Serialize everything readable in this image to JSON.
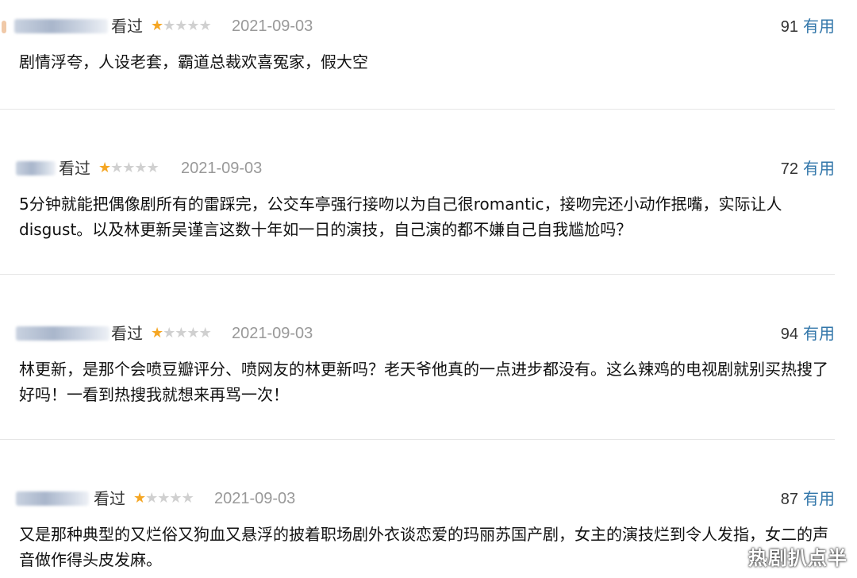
{
  "reviews": [
    {
      "watched": "看过",
      "rating": 1,
      "date": "2021-09-03",
      "useful_count": "91",
      "useful_label": "有用",
      "content": "剧情浮夸，人设老套，霸道总裁欢喜冤家，假大空"
    },
    {
      "watched": "看过",
      "rating": 1,
      "date": "2021-09-03",
      "useful_count": "72",
      "useful_label": "有用",
      "content": "5分钟就能把偶像剧所有的雷踩完，公交车亭强行接吻以为自己很romantic，接吻完还小动作抿嘴，实际让人disgust。以及林更新吴谨言这数十年如一日的演技，自己演的都不嫌自己自我尴尬吗？"
    },
    {
      "watched": "看过",
      "rating": 1,
      "date": "2021-09-03",
      "useful_count": "94",
      "useful_label": "有用",
      "content": "林更新，是那个会喷豆瓣评分、喷网友的林更新吗？老天爷他真的一点进步都没有。这么辣鸡的电视剧就别买热搜了好吗！一看到热搜我就想来再骂一次！"
    },
    {
      "watched": "看过",
      "rating": 1,
      "date": "2021-09-03",
      "useful_count": "87",
      "useful_label": "有用",
      "content": "又是那种典型的又烂俗又狗血又悬浮的披着职场剧外衣谈恋爱的玛丽苏国产剧，女主的演技烂到令人发指，女二的声音做作得头皮发麻。"
    }
  ],
  "stars_total": 5,
  "colors": {
    "star_on": "#f5a623",
    "star_off": "#d0d0d0",
    "useful_link": "#3377aa",
    "date": "#999999"
  },
  "watermark": "热剧扒点半"
}
